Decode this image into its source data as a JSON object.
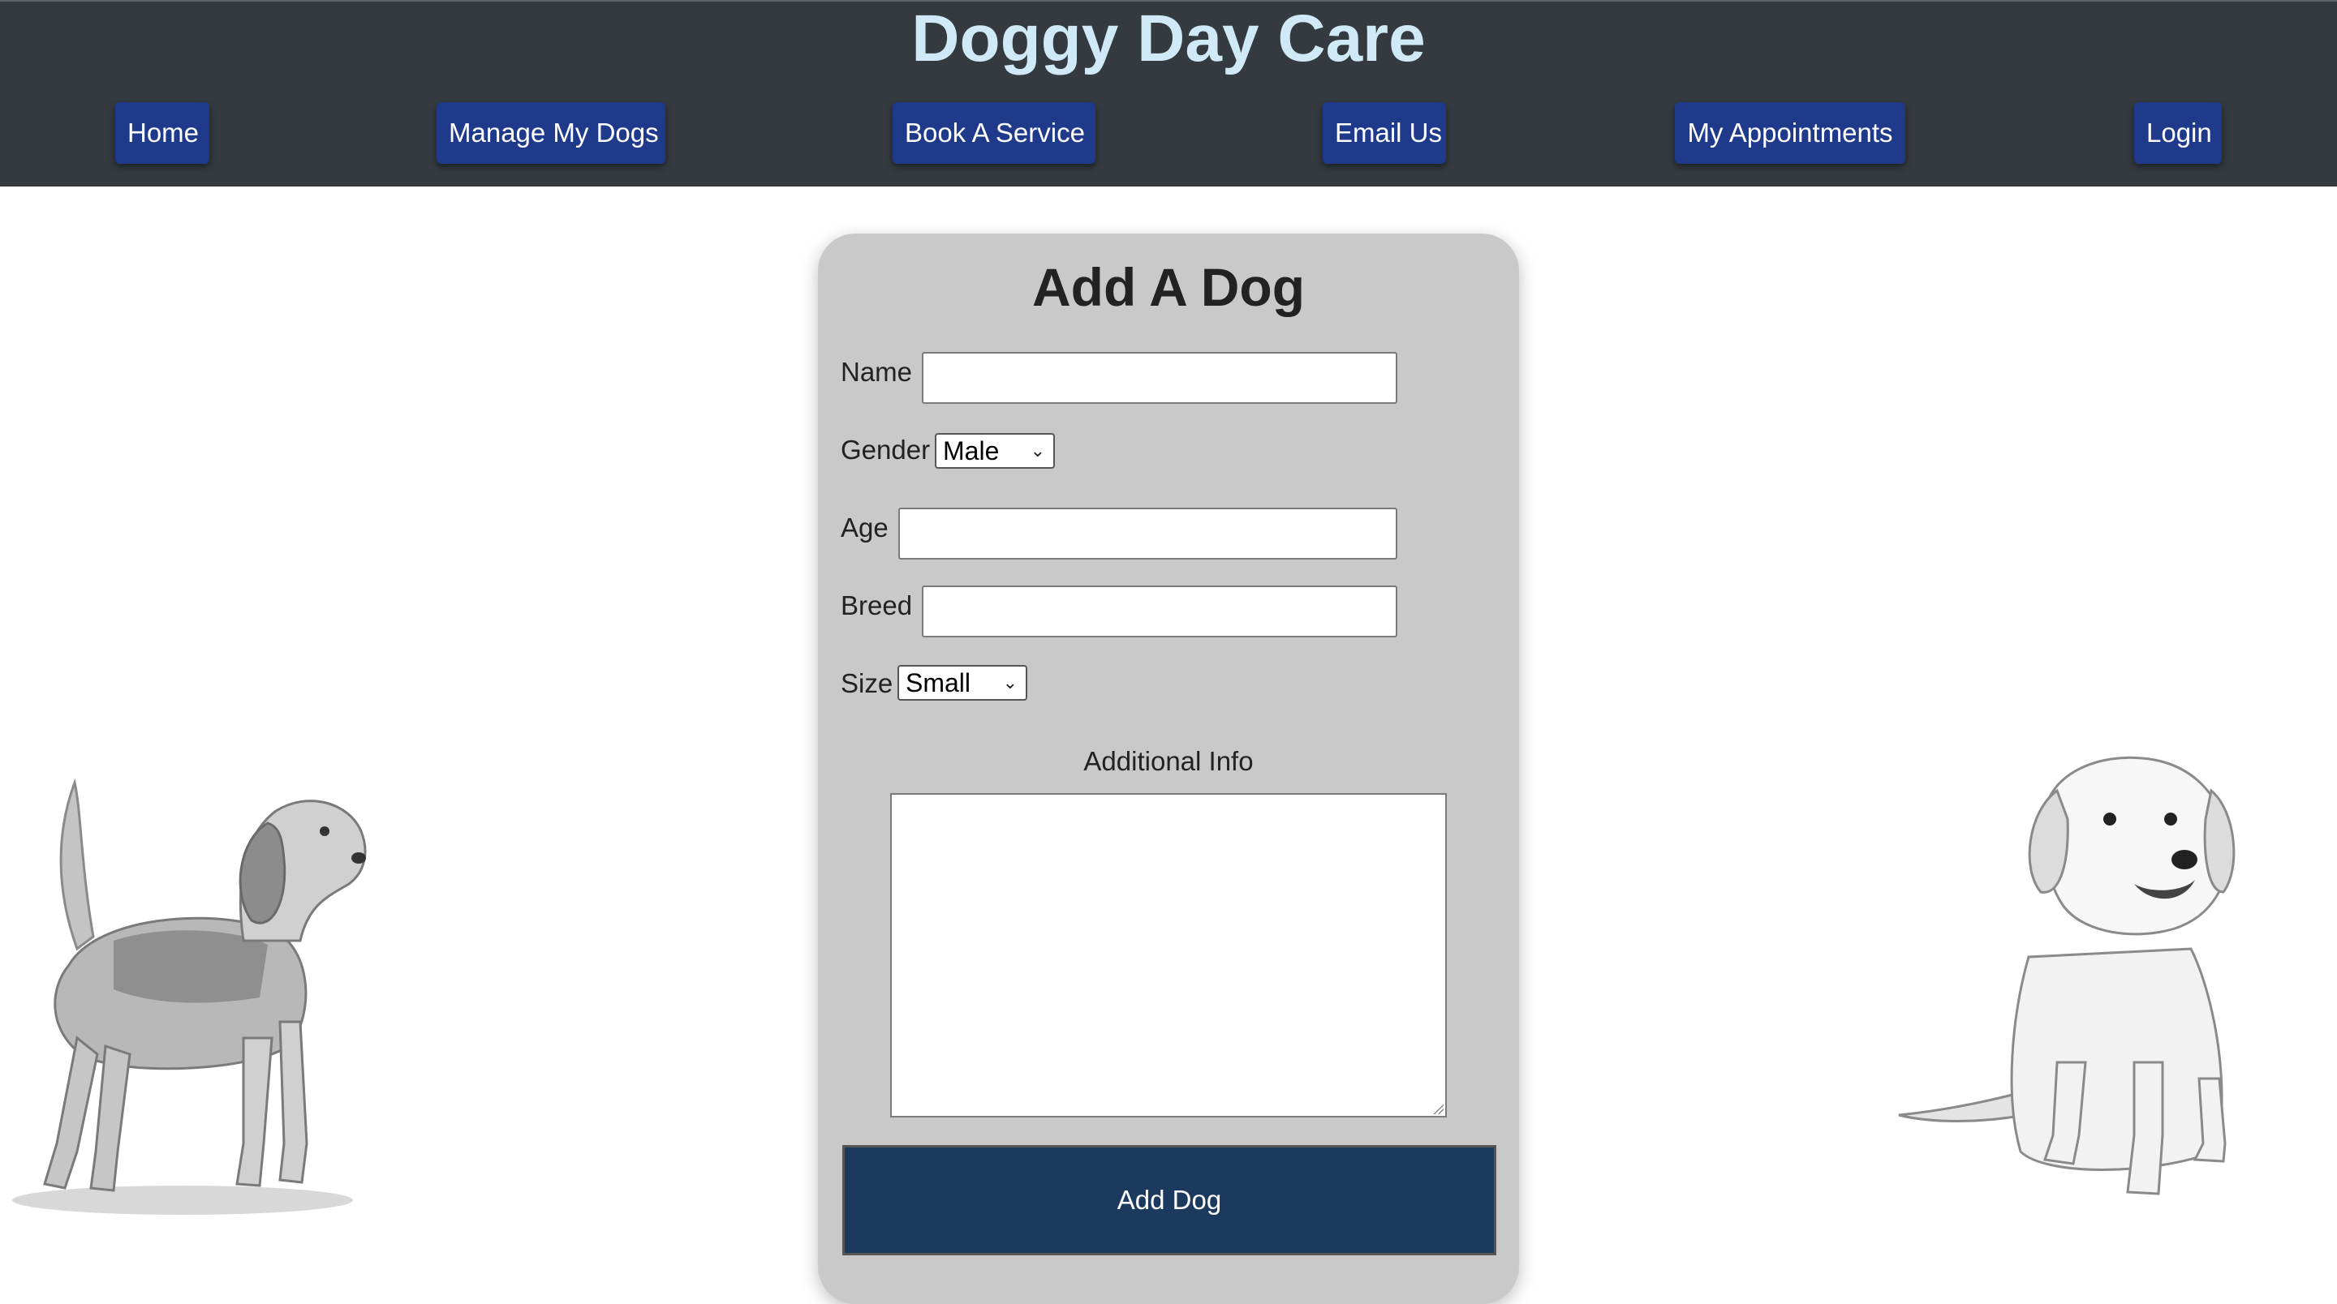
{
  "header": {
    "title": "Doggy Day Care",
    "nav": [
      {
        "label": "Home"
      },
      {
        "label": "Manage My Dogs"
      },
      {
        "label": "Book A Service"
      },
      {
        "label": "Email Us"
      },
      {
        "label": "My Appointments"
      },
      {
        "label": "Login"
      }
    ]
  },
  "form": {
    "title": "Add A Dog",
    "name_label": "Name",
    "name_value": "",
    "gender_label": "Gender",
    "gender_selected": "Male",
    "age_label": "Age",
    "age_value": "",
    "breed_label": "Breed",
    "breed_value": "",
    "size_label": "Size",
    "size_selected": "Small",
    "info_label": "Additional Info",
    "info_value": "",
    "submit_label": "Add Dog"
  },
  "colors": {
    "header_bg": "#343a40",
    "title_color": "#cfe9f7",
    "nav_button": "#1f3a8a",
    "card_bg": "#c9c9c9",
    "submit_bg": "#1c3a5e"
  },
  "images": {
    "left": "beagle-sketch",
    "right": "golden-puppy-sketch"
  }
}
